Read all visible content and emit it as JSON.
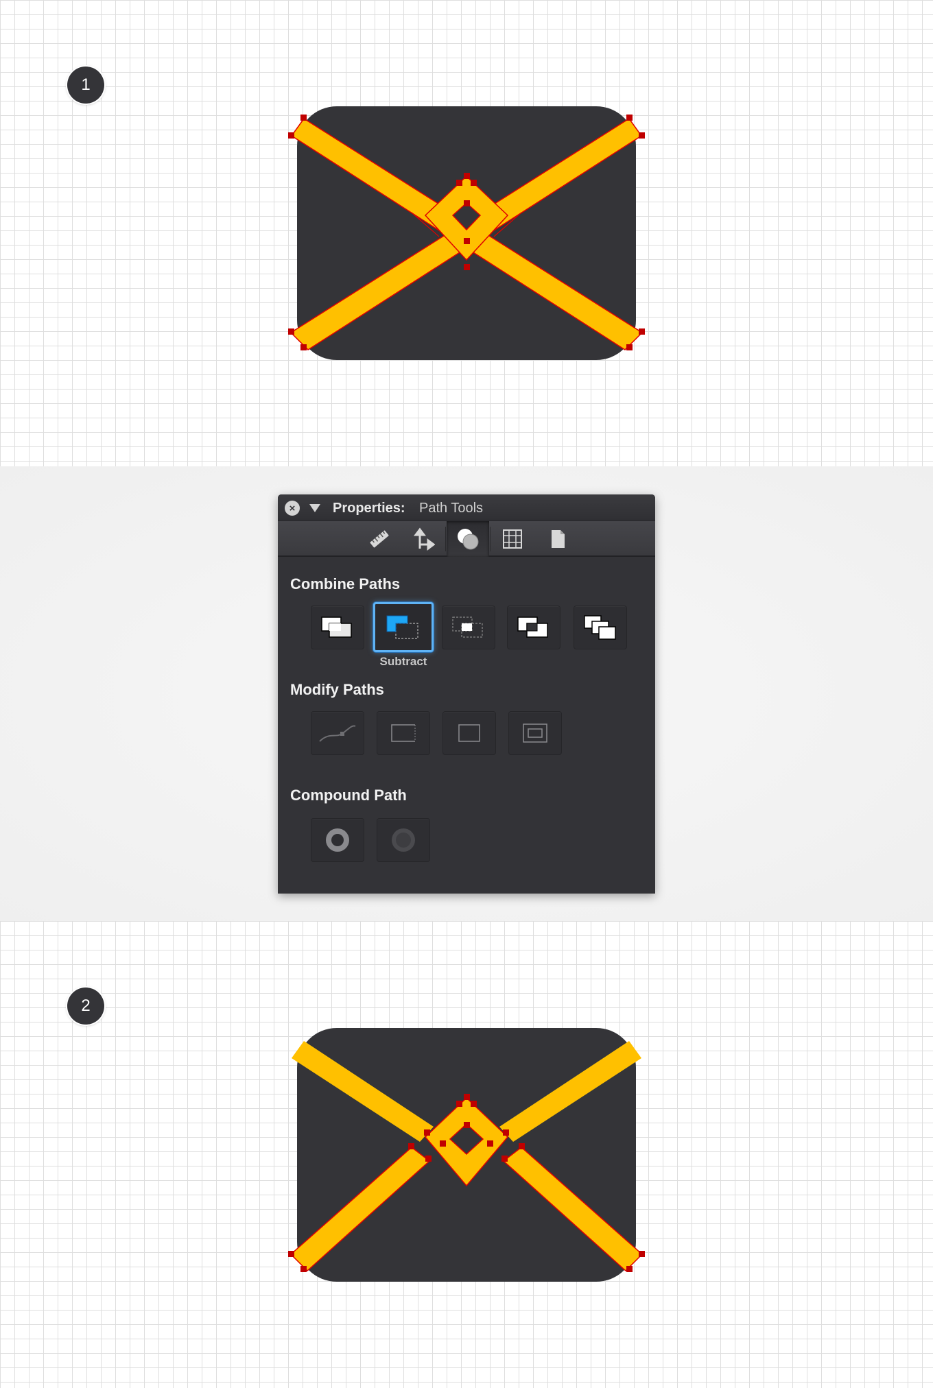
{
  "steps": {
    "first": "1",
    "second": "2"
  },
  "panel": {
    "title_label": "Properties:",
    "title_value": "Path Tools",
    "toolbar_tabs": [
      "ruler-icon",
      "transform-arrows-icon",
      "path-tools-icon",
      "grid-icon",
      "document-icon"
    ],
    "active_tab": "path-tools-icon",
    "sections": {
      "combine": {
        "title": "Combine Paths",
        "buttons": [
          "add",
          "subtract",
          "intersect",
          "divide",
          "xor"
        ],
        "selected": "subtract",
        "selected_caption": "Subtract"
      },
      "modify": {
        "title": "Modify Paths",
        "buttons": [
          "curve-path",
          "open-rect",
          "closed-rect",
          "inset-rect"
        ]
      },
      "compound": {
        "title": "Compound Path",
        "buttons": [
          "make-compound",
          "release-compound"
        ]
      }
    }
  },
  "colors": {
    "icon_body": "#343438",
    "stripe": "#ffc000",
    "anchor": "#c00000",
    "selection_outline": "#e00000",
    "panel_bg": "#333337",
    "selected_glow": "#5fb3f5"
  }
}
